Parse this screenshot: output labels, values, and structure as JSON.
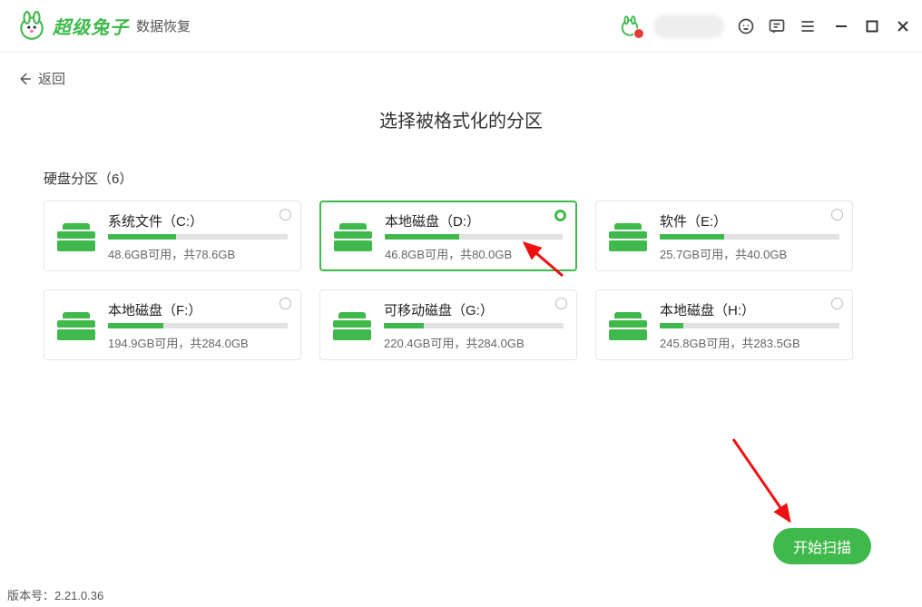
{
  "header": {
    "brand": "超级兔子",
    "product": "数据恢复"
  },
  "back_label": "返回",
  "page_title": "选择被格式化的分区",
  "section_label": "硬盘分区（6）",
  "drives": [
    {
      "title": "系统文件（C:）",
      "free": "48.6GB",
      "total": "78.6GB",
      "used_pct": 38,
      "selected": false
    },
    {
      "title": "本地磁盘（D:）",
      "free": "46.8GB",
      "total": "80.0GB",
      "used_pct": 42,
      "selected": true
    },
    {
      "title": "软件（E:）",
      "free": "25.7GB",
      "total": "40.0GB",
      "used_pct": 36,
      "selected": false
    },
    {
      "title": "本地磁盘（F:）",
      "free": "194.9GB",
      "total": "284.0GB",
      "used_pct": 31,
      "selected": false
    },
    {
      "title": "可移动磁盘（G:）",
      "free": "220.4GB",
      "total": "284.0GB",
      "used_pct": 22,
      "selected": false
    },
    {
      "title": "本地磁盘（H:）",
      "free": "245.8GB",
      "total": "283.5GB",
      "used_pct": 13,
      "selected": false
    }
  ],
  "sub_template": "{free}可用，共{total}",
  "scan_label": "开始扫描",
  "version_label": "版本号：",
  "version": "2.21.0.36"
}
